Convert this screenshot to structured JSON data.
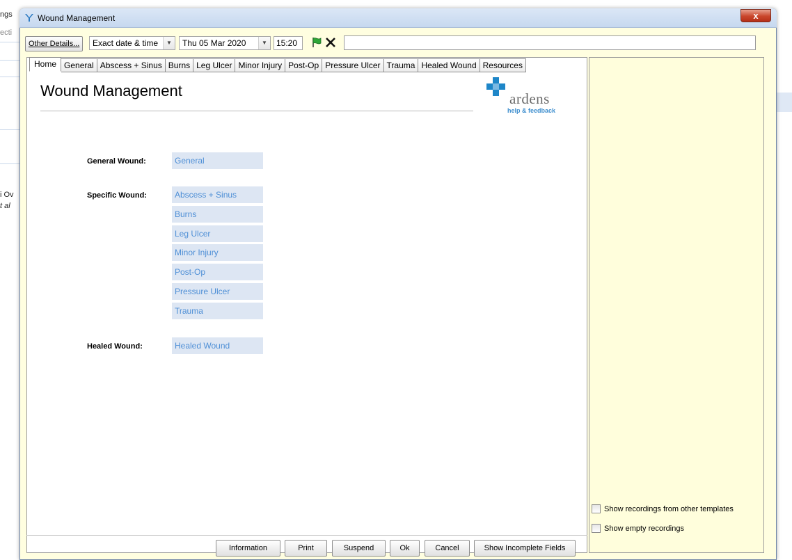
{
  "background_app": {
    "fragments": [
      "ngs",
      "ecti",
      "i Ov",
      "t al"
    ]
  },
  "window": {
    "title": "Wound Management",
    "close_label": "x"
  },
  "toolbar": {
    "other_details_label": "Other Details...",
    "date_mode": "Exact date & time",
    "date": "Thu 05 Mar 2020",
    "time": "15:20",
    "search_value": ""
  },
  "tabs": [
    {
      "label": "Home",
      "active": true
    },
    {
      "label": "General"
    },
    {
      "label": "Abscess + Sinus"
    },
    {
      "label": "Burns"
    },
    {
      "label": "Leg Ulcer"
    },
    {
      "label": "Minor Injury"
    },
    {
      "label": "Post-Op"
    },
    {
      "label": "Pressure Ulcer"
    },
    {
      "label": "Trauma"
    },
    {
      "label": "Healed Wound"
    },
    {
      "label": "Resources"
    }
  ],
  "page": {
    "title": "Wound Management",
    "logo_word": "ardens",
    "logo_sub": "help & feedback"
  },
  "sections": {
    "general_label": "General Wound:",
    "general_items": [
      "General"
    ],
    "specific_label": "Specific Wound:",
    "specific_items": [
      "Abscess + Sinus",
      "Burns",
      "Leg Ulcer",
      "Minor Injury",
      "Post-Op",
      "Pressure Ulcer",
      "Trauma"
    ],
    "healed_label": "Healed Wound:",
    "healed_items": [
      "Healed Wound"
    ]
  },
  "actions": {
    "information": "Information",
    "print": "Print",
    "suspend": "Suspend",
    "ok": "Ok",
    "cancel": "Cancel",
    "show_incomplete": "Show Incomplete Fields"
  },
  "right_panel": {
    "show_other_templates": "Show recordings from other templates",
    "show_empty": "Show empty recordings"
  },
  "colors": {
    "window_bg": "#fffee0",
    "link_blue": "#4e8fd6",
    "button_fill": "#dde6f3",
    "logo_blue": "#1e86c8"
  }
}
